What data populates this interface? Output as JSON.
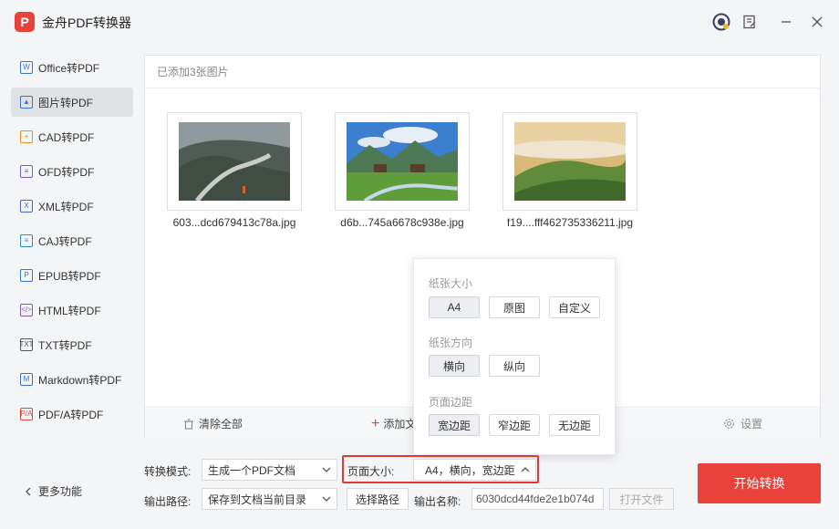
{
  "app": {
    "logo_glyph": "P",
    "title": "金舟PDF转换器"
  },
  "sidebar": {
    "items": [
      {
        "label": "Office转PDF",
        "icon": "W",
        "color": "#3b6fd9"
      },
      {
        "label": "图片转PDF",
        "icon": "▲",
        "color": "#3b6fd9"
      },
      {
        "label": "CAD转PDF",
        "icon": "+",
        "color": "#f08a24"
      },
      {
        "label": "OFD转PDF",
        "icon": "≡",
        "color": "#7a5ad8"
      },
      {
        "label": "XML转PDF",
        "icon": "X",
        "color": "#4561d0"
      },
      {
        "label": "CAJ转PDF",
        "icon": "≡",
        "color": "#2c8fd6"
      },
      {
        "label": "EPUB转PDF",
        "icon": "P",
        "color": "#3b6fd9"
      },
      {
        "label": "HTML转PDF",
        "icon": "</>",
        "color": "#8a55c9"
      },
      {
        "label": "TXT转PDF",
        "icon": "TXT",
        "color": "#555555"
      },
      {
        "label": "Markdown转PDF",
        "icon": "M",
        "color": "#3b6fd9"
      },
      {
        "label": "PDF/A转PDF",
        "icon": "P/A",
        "color": "#e8423a"
      }
    ],
    "active_index": 1,
    "more_label": "更多功能"
  },
  "panel": {
    "header": "已添加3张图片",
    "files": [
      {
        "name": "603...dcd679413c78a.jpg"
      },
      {
        "name": "d6b...745a6678c938e.jpg"
      },
      {
        "name": "f19....fff462735336211.jpg"
      }
    ],
    "footer": {
      "clear_label": "清除全部",
      "add_label": "添加文",
      "settings_label": "设置"
    }
  },
  "popup": {
    "size_label": "纸张大小",
    "size_options": [
      "A4",
      "原图",
      "自定义"
    ],
    "orient_label": "纸张方向",
    "orient_options": [
      "横向",
      "纵向"
    ],
    "margin_label": "页面边距",
    "margin_options": [
      "宽边距",
      "窄边距",
      "无边距"
    ]
  },
  "bottom": {
    "mode_label": "转换模式:",
    "mode_value": "生成一个PDF文档",
    "page_size_label": "页面大小:",
    "page_size_value": "A4，横向，宽边距",
    "output_path_label": "输出路径:",
    "output_path_value": "保存到文档当前目录",
    "choose_path_label": "选择路径",
    "output_name_label": "输出名称:",
    "output_name_value": "6030dcd44fde2e1b074d",
    "open_file_label": "打开文件",
    "start_label": "开始转换"
  },
  "colors": {
    "brand": "#e8423a",
    "highlight": "#e03a2f"
  }
}
